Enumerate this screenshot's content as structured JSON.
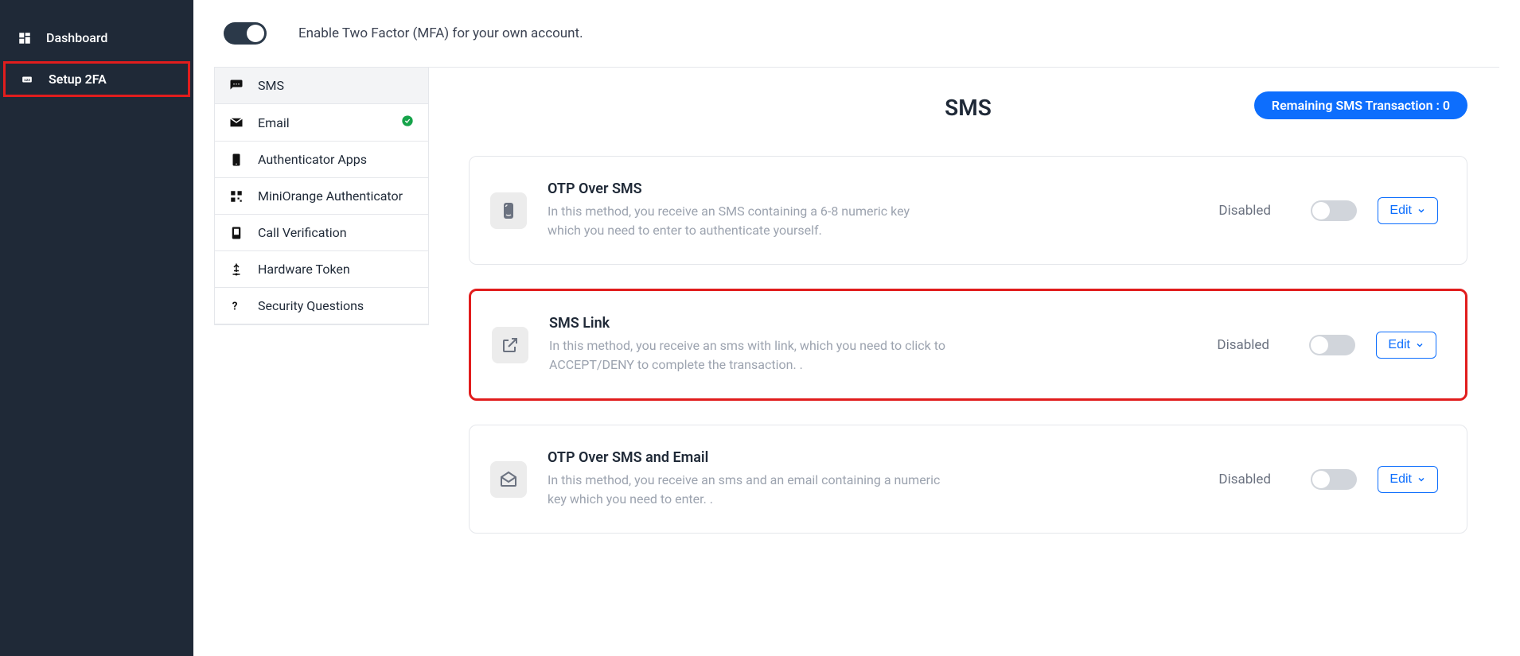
{
  "sidebar": {
    "items": [
      {
        "label": "Dashboard",
        "active": false
      },
      {
        "label": "Setup 2FA",
        "active": true
      }
    ]
  },
  "topRow": {
    "enableLabel": "Enable Two Factor (MFA) for your own account."
  },
  "methodTabs": [
    {
      "label": "SMS",
      "active": true,
      "configured": false,
      "iconName": "sms-icon"
    },
    {
      "label": "Email",
      "active": false,
      "configured": true,
      "iconName": "email-icon"
    },
    {
      "label": "Authenticator Apps",
      "active": false,
      "configured": false,
      "iconName": "phone-icon"
    },
    {
      "label": "MiniOrange Authenticator",
      "active": false,
      "configured": false,
      "iconName": "qr-icon"
    },
    {
      "label": "Call Verification",
      "active": false,
      "configured": false,
      "iconName": "call-icon"
    },
    {
      "label": "Hardware Token",
      "active": false,
      "configured": false,
      "iconName": "usb-icon"
    },
    {
      "label": "Security Questions",
      "active": false,
      "configured": false,
      "iconName": "question-icon"
    }
  ],
  "detail": {
    "title": "SMS",
    "badge": "Remaining SMS Transaction : 0",
    "editLabel": "Edit",
    "cards": [
      {
        "title": "OTP Over SMS",
        "desc": "In this method, you receive an SMS containing a 6-8 numeric key which you need to enter to authenticate yourself.",
        "status": "Disabled",
        "highlight": false,
        "iconName": "phone-sms-icon"
      },
      {
        "title": "SMS Link",
        "desc": "In this method, you receive an sms with link, which you need to click to ACCEPT/DENY to complete the transaction. .",
        "status": "Disabled",
        "highlight": true,
        "iconName": "external-link-icon"
      },
      {
        "title": "OTP Over SMS and Email",
        "desc": "In this method, you receive an sms and an email containing a numeric key which you need to enter. .",
        "status": "Disabled",
        "highlight": false,
        "iconName": "envelope-open-icon"
      }
    ]
  }
}
